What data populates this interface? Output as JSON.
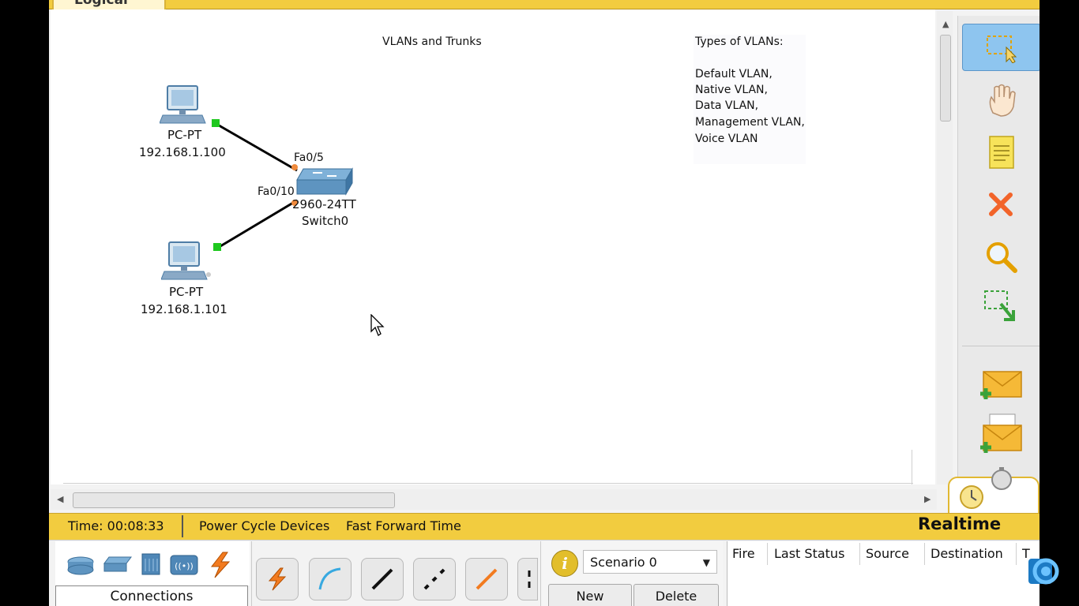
{
  "app": {
    "workspace_tab": "Logical",
    "canvas_title": "VLANs and Trunks"
  },
  "note": {
    "title": "Types of VLANs:",
    "lines": [
      "Default VLAN,",
      "Native VLAN,",
      "Data VLAN,",
      "Management VLAN,",
      "Voice VLAN"
    ]
  },
  "devices": {
    "pc1": {
      "type": "PC-PT",
      "ip": "192.168.1.100"
    },
    "pc2": {
      "type": "PC-PT",
      "ip": "192.168.1.101"
    },
    "switch": {
      "model": "2960-24TT",
      "name": "Switch0"
    }
  },
  "ports": {
    "pc1_link": "Fa0/5",
    "pc2_link": "Fa0/10"
  },
  "status": {
    "time": "Time: 00:08:33",
    "power_cycle": "Power Cycle Devices",
    "fast_forward": "Fast Forward Time",
    "mode": "Realtime"
  },
  "bottom": {
    "connections_label": "Connections",
    "scenario": "Scenario 0",
    "new_label": "New",
    "delete_label": "Delete",
    "pdu_columns": [
      "Fire",
      "Last Status",
      "Source",
      "Destination",
      "T"
    ]
  },
  "colors": {
    "accent_yellow": "#f2cc3f",
    "link_up": "#1ec81e",
    "link_pending": "#f08a3c",
    "selected_tool": "#8ec5ef"
  },
  "icons": {
    "right_toolbar": [
      "select-icon",
      "move-layout-icon",
      "note-icon",
      "delete-icon",
      "inspect-icon",
      "resize-shape-icon",
      "add-simple-pdu-icon",
      "add-complex-pdu-icon"
    ],
    "device_categories": [
      "router-icon",
      "switch-icon",
      "hub-icon",
      "wireless-icon",
      "connections-icon"
    ],
    "cable_types": [
      "auto-cable-icon",
      "console-cable-icon",
      "straight-through-cable-icon",
      "crossover-cable-icon",
      "fiber-cable-icon"
    ]
  }
}
